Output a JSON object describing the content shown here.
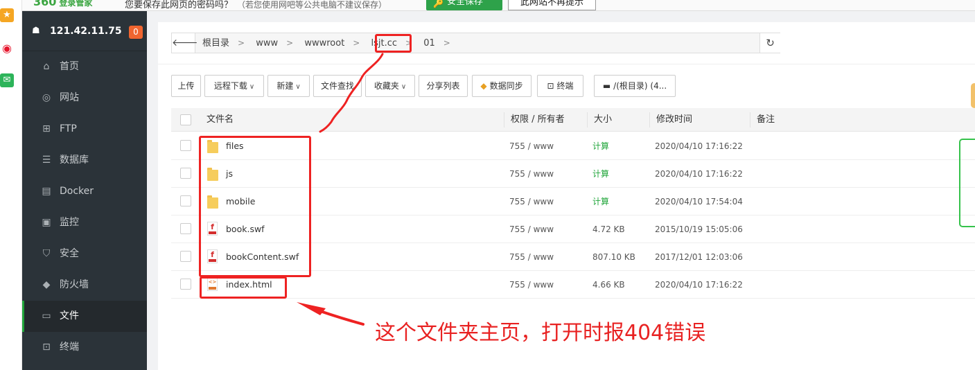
{
  "browser_prompt": {
    "logo": "360",
    "logo_sub": "登录管家",
    "message": "您要保存此网页的密码吗？",
    "hint": "（若您使用网吧等公共电脑不建议保存）",
    "save_label": "安全保存",
    "never_label": "此网站不再提示"
  },
  "sidebar": {
    "server_ip": "121.42.11.75",
    "badge": "0",
    "items": [
      {
        "label": "首页",
        "icon": "home-icon"
      },
      {
        "label": "网站",
        "icon": "globe-icon"
      },
      {
        "label": "FTP",
        "icon": "ftp-icon"
      },
      {
        "label": "数据库",
        "icon": "database-icon"
      },
      {
        "label": "Docker",
        "icon": "docker-icon"
      },
      {
        "label": "监控",
        "icon": "monitor-icon"
      },
      {
        "label": "安全",
        "icon": "shield-icon"
      },
      {
        "label": "防火墙",
        "icon": "firewall-icon"
      },
      {
        "label": "文件",
        "icon": "folder-icon"
      },
      {
        "label": "终端",
        "icon": "terminal-icon"
      }
    ],
    "active_index": 8
  },
  "path": {
    "crumbs": [
      "根目录",
      "www",
      "wwwroot",
      "lsjt.cc",
      "01"
    ]
  },
  "toolbar": {
    "upload": "上传",
    "remote_download": "远程下载",
    "new": "新建",
    "find": "文件查找",
    "favorites": "收藏夹",
    "share_list": "分享列表",
    "data_sync": "数据同步",
    "terminal": "终端",
    "disk": "/(根目录) (4..."
  },
  "table": {
    "headers": {
      "name": "文件名",
      "perm": "权限 / 所有者",
      "size": "大小",
      "mtime": "修改时间",
      "note": "备注"
    },
    "rows": [
      {
        "name": "files",
        "type": "folder",
        "perm": "755 / www",
        "size": "计算",
        "mtime": "2020/04/10 17:16:22"
      },
      {
        "name": "js",
        "type": "folder",
        "perm": "755 / www",
        "size": "计算",
        "mtime": "2020/04/10 17:16:22"
      },
      {
        "name": "mobile",
        "type": "folder",
        "perm": "755 / www",
        "size": "计算",
        "mtime": "2020/04/10 17:54:04"
      },
      {
        "name": "book.swf",
        "type": "swf",
        "perm": "755 / www",
        "size": "4.72 KB",
        "mtime": "2015/10/19 15:05:06"
      },
      {
        "name": "bookContent.swf",
        "type": "swf",
        "perm": "755 / www",
        "size": "807.10 KB",
        "mtime": "2017/12/01 12:03:06"
      },
      {
        "name": "index.html",
        "type": "html",
        "perm": "755 / www",
        "size": "4.66 KB",
        "mtime": "2020/04/10 17:16:22"
      }
    ]
  },
  "annotation": {
    "text": "这个文件夹主页，打开时报404错误",
    "color": "#ee2222"
  },
  "colors": {
    "sidebar_bg": "#2b3339",
    "accent": "#20a53a",
    "badge": "#f0652f"
  }
}
